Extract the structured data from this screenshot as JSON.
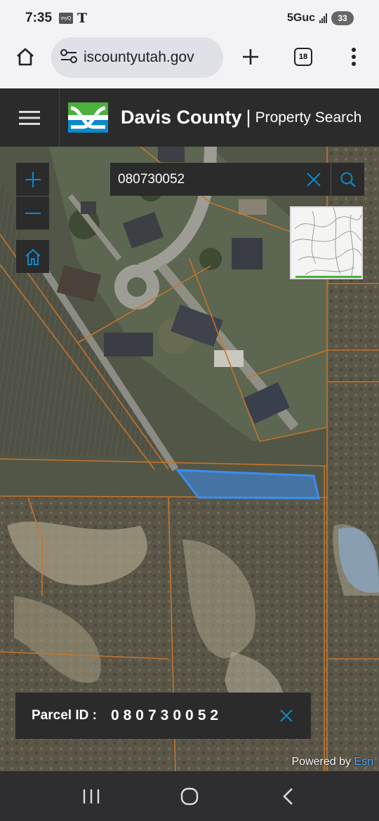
{
  "status_bar": {
    "time": "7:35",
    "notif_icon": "myq-icon",
    "carrier_icon": "tmobile-icon",
    "carrier_glyph": "T",
    "network": "5Guc",
    "battery": "33"
  },
  "browser": {
    "url": "iscountyutah.gov",
    "tab_count": "18",
    "icons": [
      "home-icon",
      "site-settings-icon",
      "new-tab-icon",
      "tab-switcher-icon",
      "more-icon"
    ]
  },
  "app": {
    "title": "Davis County",
    "separator": "|",
    "subtitle": "Property Search",
    "accent": "#0b8ac9",
    "logo_green": "#4caf3e"
  },
  "map": {
    "search_value": "080730052",
    "zoom_in": "+",
    "zoom_out": "−",
    "parcel_highlight": "#3a8ef0",
    "parcel_line": "#c4742c",
    "info": {
      "label": "Parcel ID :",
      "value": "080730052"
    },
    "attribution": {
      "prefix": "Powered by",
      "brand": "Esri"
    }
  },
  "nav": {
    "icons": [
      "recent-apps-icon",
      "home-nav-icon",
      "back-icon"
    ]
  }
}
